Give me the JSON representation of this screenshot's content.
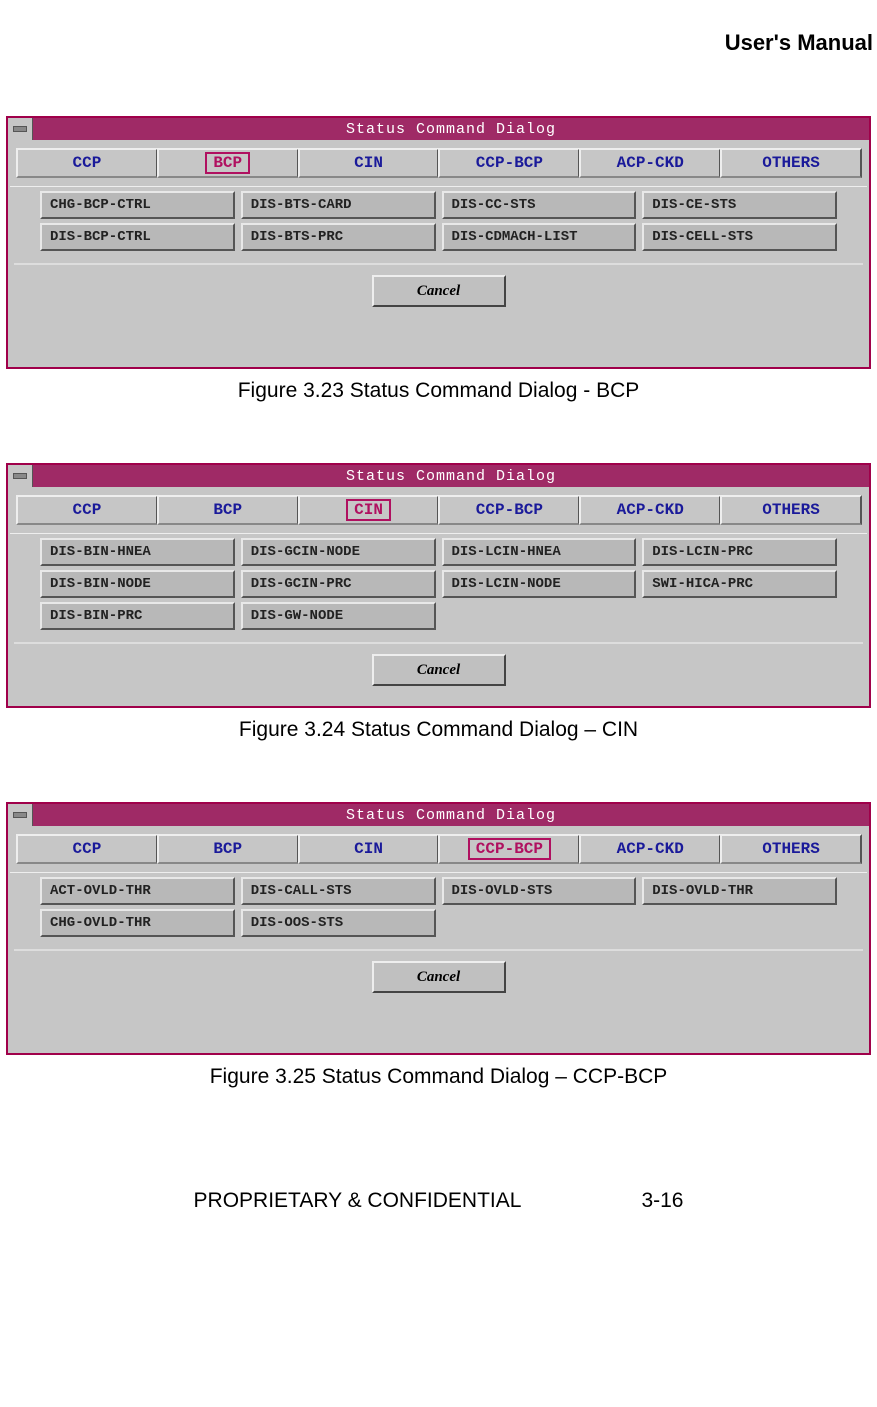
{
  "header": "User's Manual",
  "dialogs": [
    {
      "title": "Status Command Dialog",
      "tabs": [
        "CCP",
        "BCP",
        "CIN",
        "CCP-BCP",
        "ACP-CKD",
        "OTHERS"
      ],
      "active_tab": 1,
      "commands": [
        "CHG-BCP-CTRL",
        "DIS-BTS-CARD",
        "DIS-CC-STS",
        "DIS-CE-STS",
        "DIS-BCP-CTRL",
        "DIS-BTS-PRC",
        "DIS-CDMACH-LIST",
        "DIS-CELL-STS"
      ],
      "cancel": "Cancel",
      "caption": "Figure 3.23 Status Command Dialog - BCP",
      "pad": true
    },
    {
      "title": "Status Command Dialog",
      "tabs": [
        "CCP",
        "BCP",
        "CIN",
        "CCP-BCP",
        "ACP-CKD",
        "OTHERS"
      ],
      "active_tab": 2,
      "commands": [
        "DIS-BIN-HNEA",
        "DIS-GCIN-NODE",
        "DIS-LCIN-HNEA",
        "DIS-LCIN-PRC",
        "DIS-BIN-NODE",
        "DIS-GCIN-PRC",
        "DIS-LCIN-NODE",
        "SWI-HICA-PRC",
        "DIS-BIN-PRC",
        "DIS-GW-NODE"
      ],
      "cancel": "Cancel",
      "caption": "Figure 3.24 Status Command Dialog – CIN",
      "pad": false
    },
    {
      "title": "Status Command Dialog",
      "tabs": [
        "CCP",
        "BCP",
        "CIN",
        "CCP-BCP",
        "ACP-CKD",
        "OTHERS"
      ],
      "active_tab": 3,
      "commands": [
        "ACT-OVLD-THR",
        "DIS-CALL-STS",
        "DIS-OVLD-STS",
        "DIS-OVLD-THR",
        "CHG-OVLD-THR",
        "DIS-OOS-STS"
      ],
      "cancel": "Cancel",
      "caption": "Figure 3.25 Status Command Dialog – CCP-BCP",
      "pad": true
    }
  ],
  "footer": {
    "left": "PROPRIETARY & CONFIDENTIAL",
    "right": "3-16"
  }
}
